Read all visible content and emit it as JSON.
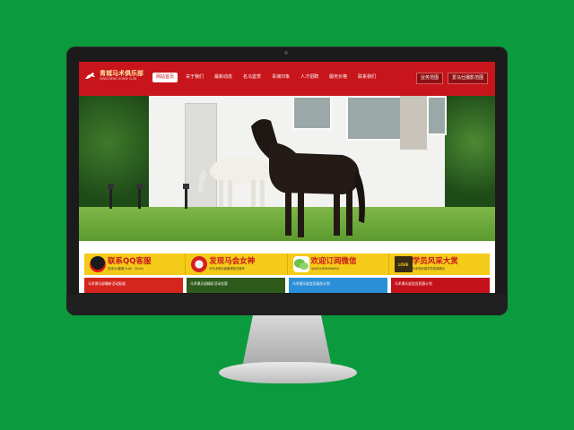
{
  "site": {
    "logo_title": "青城马术俱乐部",
    "logo_subtitle": "QINGCHENG HORSE CLUB"
  },
  "nav": {
    "items": [
      {
        "label": "网站首页",
        "active": true
      },
      {
        "label": "关于我们",
        "active": false
      },
      {
        "label": "最新动态",
        "active": false
      },
      {
        "label": "名马鉴赏",
        "active": false
      },
      {
        "label": "青城印象",
        "active": false
      },
      {
        "label": "人才招聘",
        "active": false
      },
      {
        "label": "服务价格",
        "active": false
      },
      {
        "label": "联系我们",
        "active": false
      }
    ],
    "btn_left": "业务范围",
    "btn_right": "爱马仕摄影范围"
  },
  "promos": [
    {
      "title": "联系QQ客服",
      "subtitle": "在线QQ客服 9:00 - 20:00",
      "title_color": "#c8151b",
      "icon": "qq-icon"
    },
    {
      "title": "发现马会女神",
      "subtitle": "@马术俱乐部微博官方账号",
      "title_color": "#c8151b",
      "icon": "weibo-icon"
    },
    {
      "title": "欢迎订阅微信",
      "subtitle": "QINGCHENGMAHUI",
      "title_color": "#c8151b",
      "icon": "wechat-icon"
    },
    {
      "title": "学员风采大赏",
      "subtitle": "马术俱乐部学员风采展示",
      "title_color": "#c8151b",
      "icon": "love-icon",
      "icon_text": "LOVE"
    }
  ],
  "cards": [
    {
      "label": "马术俱乐部最新活动报道"
    },
    {
      "label": "马术俱乐部精彩活动花絮"
    },
    {
      "label": "马术俱乐部会员服务计划"
    },
    {
      "label": "马术俱乐部会员招募计划"
    }
  ]
}
